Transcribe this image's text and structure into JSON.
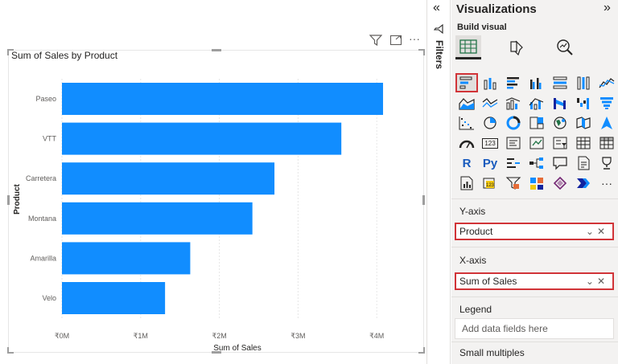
{
  "visual": {
    "title": "Sum of Sales by Product",
    "header_icons": [
      "filter-icon",
      "focus-mode-icon",
      "more-options-icon"
    ]
  },
  "chart_data": {
    "type": "bar",
    "orientation": "horizontal",
    "categories": [
      "Paseo",
      "VTT",
      "Carretera",
      "Montana",
      "Amarilla",
      "Velo"
    ],
    "values": [
      4.08,
      3.55,
      2.7,
      2.42,
      1.63,
      1.31
    ],
    "value_unit": "₹ M",
    "xlabel": "Sum of Sales",
    "ylabel": "Product",
    "xlim": [
      0,
      4.3
    ],
    "x_ticks": [
      "₹0M",
      "₹1M",
      "₹2M",
      "₹3M",
      "₹4M"
    ],
    "grid": true,
    "bar_color": "#118dff"
  },
  "filters": {
    "label": "Filters",
    "collapse_icon": "collapse-left-icon"
  },
  "viz_pane": {
    "title": "Visualizations",
    "expand_icon": "expand-right-icon",
    "build_label": "Build visual",
    "y_axis": {
      "label": "Y-axis",
      "field": "Product"
    },
    "x_axis": {
      "label": "X-axis",
      "field": "Sum of Sales"
    },
    "legend": {
      "label": "Legend",
      "placeholder": "Add data fields here"
    },
    "small_multiples": {
      "label": "Small multiples"
    },
    "r_label": "R",
    "py_label": "Py",
    "card_label": "123",
    "more_label": "···"
  },
  "colors": {
    "accent_red": "#d13438",
    "bar_blue": "#118dff",
    "pane_bg": "#f3f2f1"
  }
}
